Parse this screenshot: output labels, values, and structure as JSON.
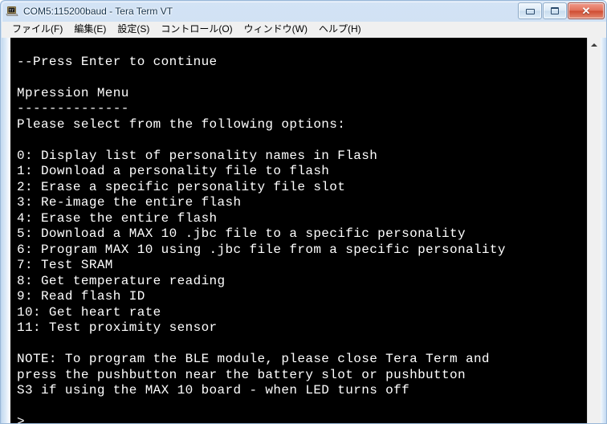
{
  "window": {
    "title": "COM5:115200baud - Tera Term VT",
    "icon": "terminal-laptop-icon",
    "frame_color": "#bcd5ef",
    "controls": {
      "minimize_label": "",
      "maximize_label": "",
      "close_label": "✕"
    }
  },
  "menubar": {
    "items": [
      {
        "label": "ファイル(F)",
        "name": "menu-file"
      },
      {
        "label": "編集(E)",
        "name": "menu-edit"
      },
      {
        "label": "設定(S)",
        "name": "menu-setup"
      },
      {
        "label": "コントロール(O)",
        "name": "menu-control"
      },
      {
        "label": "ウィンドウ(W)",
        "name": "menu-window"
      },
      {
        "label": "ヘルプ(H)",
        "name": "menu-help"
      }
    ]
  },
  "terminal": {
    "background": "#000000",
    "foreground": "#ffffff",
    "content": "\n--Press Enter to continue\n\nMpression Menu\n--------------\nPlease select from the following options:\n\n0: Display list of personality names in Flash\n1: Download a personality file to flash\n2: Erase a specific personality file slot\n3: Re-image the entire flash\n4: Erase the entire flash\n5: Download a MAX 10 .jbc file to a specific personality\n6: Program MAX 10 using .jbc file from a specific personality\n7: Test SRAM\n8: Get temperature reading\n9: Read flash ID\n10: Get heart rate\n11: Test proximity sensor\n\nNOTE: To program the BLE module, please close Tera Term and\npress the pushbutton near the battery slot or pushbutton\nS3 if using the MAX 10 board - when LED turns off\n\n>",
    "prompt": ">",
    "lines": [
      "",
      "--Press Enter to continue",
      "",
      "Mpression Menu",
      "--------------",
      "Please select from the following options:",
      "",
      "0: Display list of personality names in Flash",
      "1: Download a personality file to flash",
      "2: Erase a specific personality file slot",
      "3: Re-image the entire flash",
      "4: Erase the entire flash",
      "5: Download a MAX 10 .jbc file to a specific personality",
      "6: Program MAX 10 using .jbc file from a specific personality",
      "7: Test SRAM",
      "8: Get temperature reading",
      "9: Read flash ID",
      "10: Get heart rate",
      "11: Test proximity sensor",
      "",
      "NOTE: To program the BLE module, please close Tera Term and",
      "press the pushbutton near the battery slot or pushbutton",
      "S3 if using the MAX 10 board - when LED turns off",
      "",
      ">"
    ]
  },
  "scrollbar": {
    "name": "vertical-scrollbar",
    "up_arrow": "▲"
  }
}
